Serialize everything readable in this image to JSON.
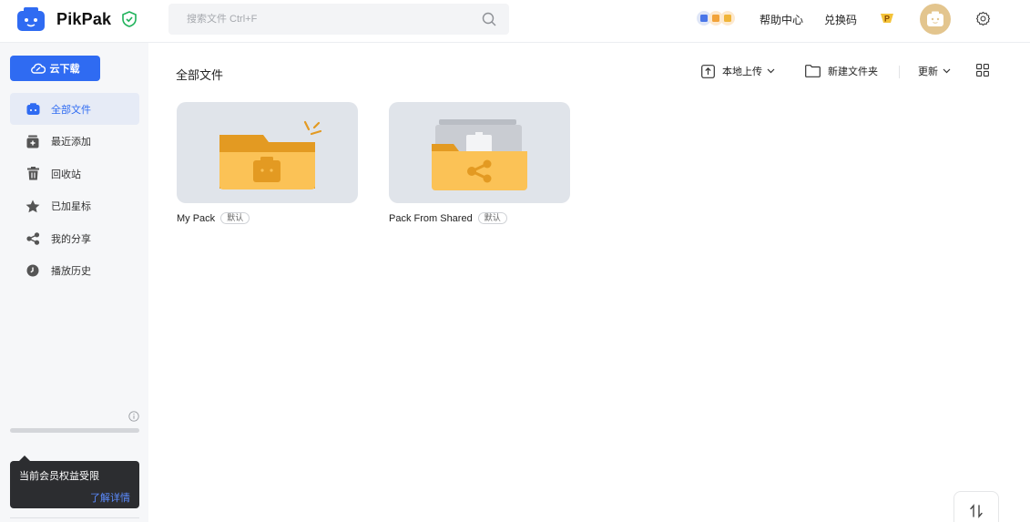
{
  "app": {
    "name": "PikPak",
    "brand_color": "#2f6bf2"
  },
  "header": {
    "search_placeholder": "搜索文件 Ctrl+F",
    "help_label": "帮助中心",
    "redeem_label": "兑换码",
    "premium_badge": "P",
    "icons": [
      "app-logo-icon",
      "verified-shield-icon",
      "search-icon",
      "apps-bundle-icon",
      "premium-p-icon",
      "avatar-icon",
      "settings-gear-icon"
    ]
  },
  "sidebar": {
    "download_button": "云下载",
    "items": [
      {
        "label": "全部文件",
        "icon": "folder-icon",
        "active": true
      },
      {
        "label": "最近添加",
        "icon": "recent-add-icon",
        "active": false
      },
      {
        "label": "回收站",
        "icon": "trash-icon",
        "active": false
      },
      {
        "label": "已加星标",
        "icon": "star-icon",
        "active": false
      },
      {
        "label": "我的分享",
        "icon": "share-icon",
        "active": false
      },
      {
        "label": "播放历史",
        "icon": "clock-icon",
        "active": false
      }
    ],
    "tooltip": {
      "title": "当前会员权益受限",
      "link": "了解详情"
    }
  },
  "main": {
    "title": "全部文件",
    "toolbar": {
      "upload_label": "本地上传",
      "new_folder_label": "新建文件夹",
      "sort_label": "更新"
    },
    "folders": [
      {
        "name": "My Pack",
        "tag": "默认",
        "type": "pack"
      },
      {
        "name": "Pack From Shared",
        "tag": "默认",
        "type": "shared"
      }
    ]
  }
}
